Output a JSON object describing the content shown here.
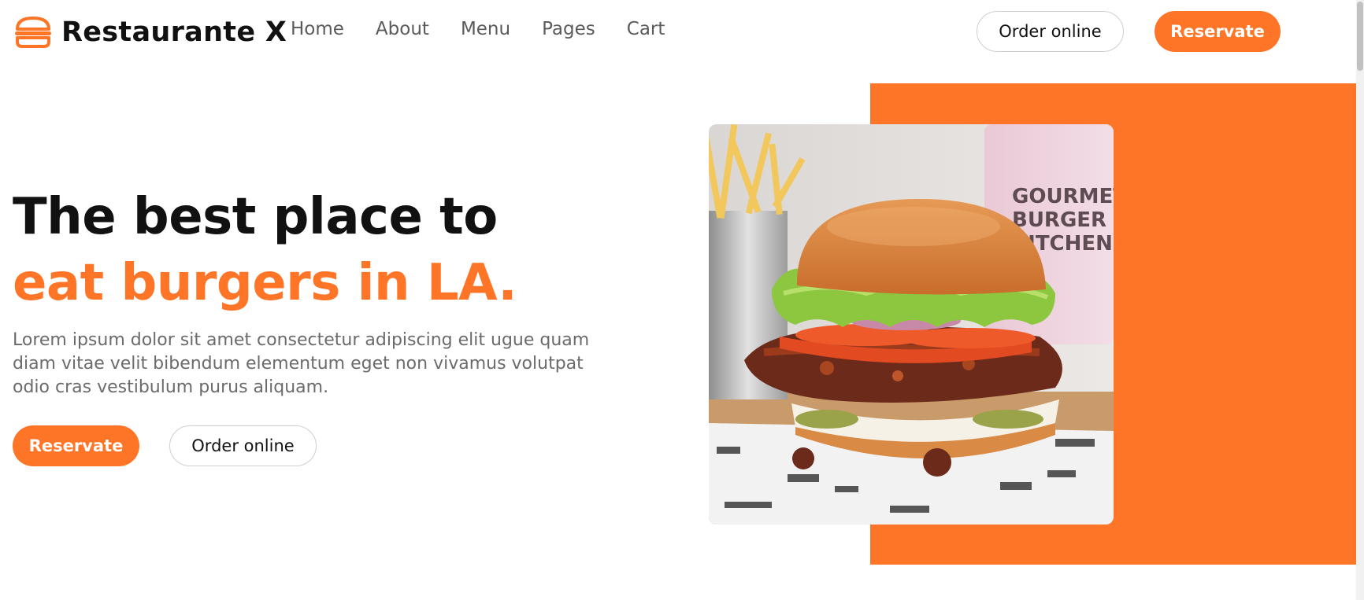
{
  "header": {
    "brand": "Restaurante X",
    "logo_icon": "burger-icon",
    "nav": [
      {
        "label": "Home"
      },
      {
        "label": "About"
      },
      {
        "label": "Menu"
      },
      {
        "label": "Pages"
      },
      {
        "label": "Cart"
      }
    ],
    "order_label": "Order online",
    "reserve_label": "Reservate"
  },
  "hero": {
    "title_line1": "The best place to",
    "title_line2": "eat burgers in LA.",
    "description": "Lorem ipsum dolor sit amet consectetur adipiscing elit ugue quam diam vitae velit bibendum elementum eget non vivamus volutpat odio cras vestibulum purus aliquam.",
    "reserve_label": "Reservate",
    "order_label": "Order online",
    "image_cup_text": "GOURMET BURGER KITCHEN"
  },
  "colors": {
    "accent": "#ff7527",
    "text_dark": "#111111",
    "text_muted": "#6b6b6b"
  }
}
